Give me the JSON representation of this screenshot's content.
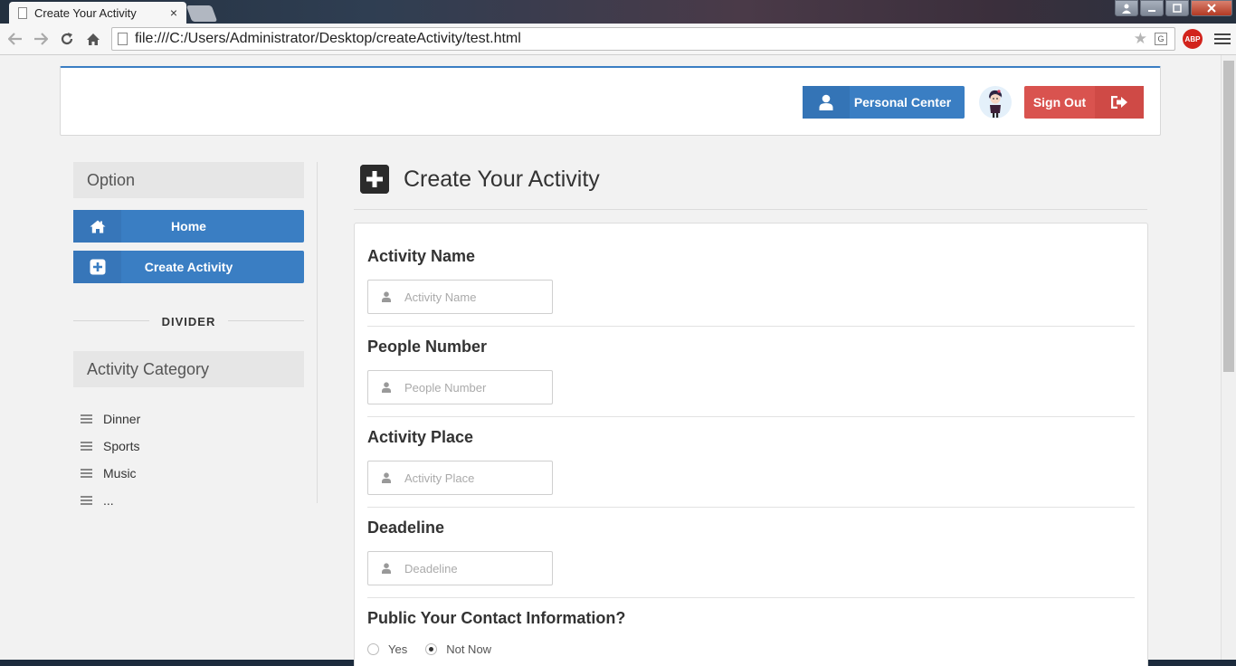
{
  "browser": {
    "tab_title": "Create Your Activity",
    "tab_close": "×",
    "url": "file:///C:/Users/Administrator/Desktop/createActivity/test.html",
    "abp_label": "ABP",
    "icons": [
      "page-icon",
      "back-arrow-icon",
      "forward-arrow-icon",
      "reload-icon",
      "home-icon",
      "star-icon",
      "translate-icon",
      "adblock-icon",
      "menu-icon"
    ]
  },
  "header": {
    "personal_center_label": "Personal Center",
    "sign_out_label": "Sign Out",
    "colors": {
      "primary": "#3a7ec3",
      "danger": "#d9534f"
    }
  },
  "sidebar": {
    "option_title": "Option",
    "buttons": [
      {
        "label": "Home",
        "icon": "home-icon"
      },
      {
        "label": "Create Activity",
        "icon": "plus-square-icon"
      }
    ],
    "divider_label": "DIVIDER",
    "category_title": "Activity Category",
    "categories": [
      {
        "label": "Dinner"
      },
      {
        "label": "Sports"
      },
      {
        "label": "Music"
      },
      {
        "label": "..."
      }
    ]
  },
  "main": {
    "title": "Create Your Activity",
    "fields": [
      {
        "label": "Activity Name",
        "placeholder": "Activity Name",
        "value": ""
      },
      {
        "label": "People Number",
        "placeholder": "People Number",
        "value": ""
      },
      {
        "label": "Activity Place",
        "placeholder": "Activity Place",
        "value": ""
      },
      {
        "label": "Deadeline",
        "placeholder": "Deadeline",
        "value": ""
      }
    ],
    "contact_question": "Public Your Contact Information?",
    "contact_options": [
      {
        "label": "Yes",
        "selected": false
      },
      {
        "label": "Not Now",
        "selected": true
      }
    ]
  }
}
